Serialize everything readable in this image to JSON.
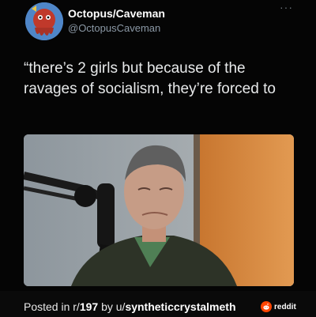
{
  "author": {
    "name": "Octopus/Caveman",
    "handle": "@OctopusCaveman"
  },
  "more_icon": "more-dots-icon",
  "tweet": {
    "text": "“there’s 2 girls but because of the ravages of socialism, they’re forced to"
  },
  "media": {
    "description_icon": "embedded-video-frame"
  },
  "footer": {
    "posted_prefix": "Posted in r/",
    "subreddit": "197",
    "by_text": " by u/",
    "username": "syntheticcrystalmeth",
    "brand": "reddit"
  },
  "colors": {
    "background": "#000000",
    "handle": "#8b98a5",
    "reddit_orange": "#ff4500"
  }
}
